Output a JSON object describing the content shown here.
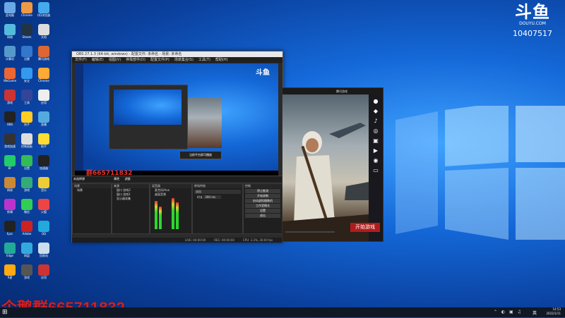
{
  "brand": {
    "logo": "斗鱼",
    "sub": "DOUYU.COM",
    "room_id": "10407517"
  },
  "watermark": "企鹅群665711832",
  "obs": {
    "title": "OBS 27.1.3 (64-bit, windows) - 配置文件: 未命名 - 场景: 未命名",
    "menu": [
      "文件(F)",
      "编辑(E)",
      "视图(V)",
      "停靠部件(D)",
      "配置文件(P)",
      "场景集合(S)",
      "工具(T)",
      "帮助(H)"
    ],
    "preview_watermark": "群665711832",
    "preview_tooltip": "当前平台即可播放",
    "dock_header": "未选择源",
    "dock_tabs": {
      "properties": "属性",
      "filters": "滤镜"
    },
    "panels": {
      "scenes": "场景",
      "sources": "来源",
      "mixer": "混音器",
      "transitions": "转场特效",
      "controls": "控制"
    },
    "scene_items": [
      "场景"
    ],
    "source_items": [
      "窗口 游戏2",
      "窗口 游戏1",
      "显示器采集"
    ],
    "mixer_items": [
      "麦克风/Aux",
      "桌面音频"
    ],
    "transition": {
      "type": "淡出",
      "duration_label": "时长",
      "duration_value": "300 ms"
    },
    "controls": [
      "停止推流",
      "开始录制",
      "启动虚拟摄像机",
      "工作室模式",
      "设置",
      "退出"
    ],
    "status": {
      "live": "LIVE: 00:00:00",
      "rec": "REC: 00:00:00",
      "cpu": "CPU: 3.3%, 30.00 fps"
    }
  },
  "game": {
    "title": "腾讯游戏",
    "play_button": "开始游戏",
    "side_icons": [
      "微信",
      "QQ",
      "抖音",
      "微博",
      "斗鱼",
      "快手",
      "Steam",
      "游戏"
    ]
  },
  "taskbar": {
    "time": "14:53",
    "date": "2022/1/11",
    "tray_text": "英"
  },
  "desktop_icons": [
    {
      "label": "此电脑",
      "color": "#6aa8e8"
    },
    {
      "label": "Chrome",
      "color": "#e94"
    },
    {
      "label": "QQ浏览器",
      "color": "#4ae"
    },
    {
      "label": "网络",
      "color": "#5bd"
    },
    {
      "label": "Steam",
      "color": "#234"
    },
    {
      "label": "文档",
      "color": "#ddd"
    },
    {
      "label": "计算机",
      "color": "#59c"
    },
    {
      "label": "迅雷",
      "color": "#37c"
    },
    {
      "label": "腾讯游戏",
      "color": "#d63"
    },
    {
      "label": "WeGame",
      "color": "#e63"
    },
    {
      "label": "安全",
      "color": "#39e"
    },
    {
      "label": "Chrome",
      "color": "#fa3"
    },
    {
      "label": "游戏",
      "color": "#c33"
    },
    {
      "label": "工具",
      "color": "#349"
    },
    {
      "label": "应用",
      "color": "#eee"
    },
    {
      "label": "OBS",
      "color": "#222"
    },
    {
      "label": "快手",
      "color": "#fc2"
    },
    {
      "label": "直播",
      "color": "#5ad"
    },
    {
      "label": "游戏加速",
      "color": "#333"
    },
    {
      "label": "控制面板",
      "color": "#ddd"
    },
    {
      "label": "助手",
      "color": "#fd3"
    },
    {
      "label": "BF",
      "color": "#2c6"
    },
    {
      "label": "设置",
      "color": "#3b5"
    },
    {
      "label": "加速器",
      "color": "#222"
    },
    {
      "label": "网易",
      "color": "#c83"
    },
    {
      "label": "游戏",
      "color": "#3a7"
    },
    {
      "label": "音乐",
      "color": "#ec3"
    },
    {
      "label": "剪辑",
      "color": "#b3c"
    },
    {
      "label": "微信",
      "color": "#3c5"
    },
    {
      "label": "火狐",
      "color": "#e44"
    },
    {
      "label": "Epic",
      "color": "#222"
    },
    {
      "label": "Adobe",
      "color": "#c22"
    },
    {
      "label": "QQ",
      "color": "#2ad"
    },
    {
      "label": "Edge",
      "color": "#2a9"
    },
    {
      "label": "网盘",
      "color": "#3ad"
    },
    {
      "label": "回收站",
      "color": "#cde"
    },
    {
      "label": "R星",
      "color": "#fa1"
    },
    {
      "label": "游戏",
      "color": "#555"
    },
    {
      "label": "应用",
      "color": "#c33"
    }
  ]
}
